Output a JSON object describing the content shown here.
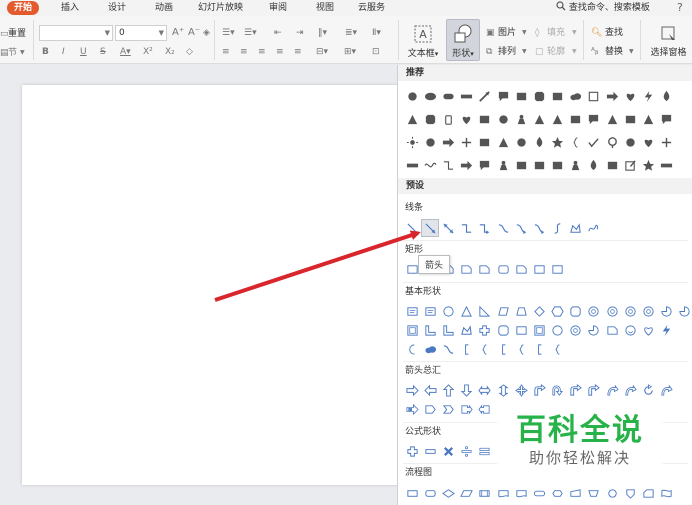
{
  "menu": {
    "tabs": [
      "开始",
      "插入",
      "设计",
      "动画",
      "幻灯片放映",
      "审阅",
      "视图",
      "云服务"
    ],
    "search": "查找命令、搜索模板",
    "help": "?"
  },
  "ribbon": {
    "row1_left": "重置",
    "row2_left": "节",
    "font_name": "",
    "font_size": "0",
    "textbox_label": "文本框",
    "shapes_label": "形状",
    "picture_label": "图片",
    "arrange_label": "排列",
    "fill_label": "填充",
    "outline_label": "轮廓",
    "find_label": "查找",
    "replace_label": "替换",
    "select_pane_label": "选择窗格"
  },
  "panel": {
    "recommended_title": "推荐",
    "preset_title": "预设",
    "lines_title": "线条",
    "rect_title": "矩形",
    "basic_title": "基本形状",
    "arrows_title": "箭头总汇",
    "formula_title": "公式形状",
    "flowchart_title": "流程图"
  },
  "tooltip": "箭头",
  "watermark": {
    "title": "百科全说",
    "subtitle": "助你轻松解决"
  },
  "colors": {
    "accent_tab": "#e35a2c",
    "shape_blue": "#4a78c2",
    "rec_gray": "#555555",
    "annotation_arrow": "#d8262c",
    "watermark_green": "#27b24a"
  },
  "icons": {
    "search": "search-icon",
    "shapes": "shapes-icon",
    "textbox": "textbox-icon",
    "picture": "picture-icon"
  }
}
